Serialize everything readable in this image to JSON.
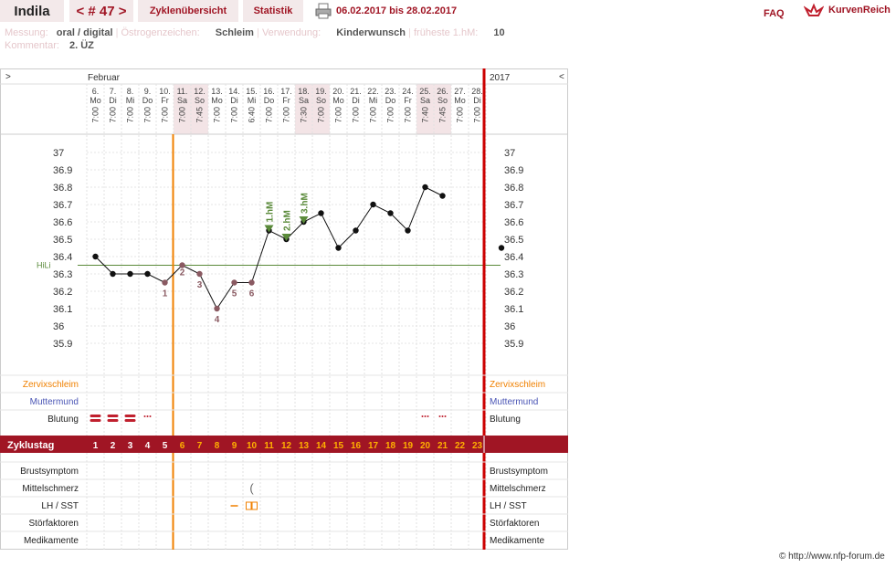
{
  "header": {
    "user": "Indila",
    "cycle": "< # 47 >",
    "tab_overview": "Zyklenübersicht",
    "tab_stats": "Statistik",
    "date_range": "06.02.2017 bis 28.02.2017",
    "faq": "FAQ",
    "brand": "KurvenReich"
  },
  "info": {
    "messung_label": "Messung:",
    "messung_value": "oral / digital",
    "oestro_label": "Östrogenzeichen:",
    "oestro_value": "Schleim",
    "verwendung_label": "Verwendung:",
    "verwendung_value": "Kinderwunsch",
    "hm_label": "früheste 1.hM:",
    "hm_value": "10",
    "kommentar_label": "Kommentar:",
    "kommentar_value": "2. ÜZ"
  },
  "chart_nav": {
    "left": ">",
    "right": "<",
    "month": "Februar",
    "year": "2017"
  },
  "chart_data": {
    "type": "line",
    "title": "",
    "ylim": [
      35.9,
      37.0
    ],
    "yticks": [
      "37",
      "36.9",
      "36.8",
      "36.7",
      "36.6",
      "36.5",
      "36.4",
      "36.3",
      "36.2",
      "36.1",
      "36",
      "35.9"
    ],
    "hili": {
      "label": "HiLi",
      "value": 36.35
    },
    "days": [
      {
        "date": "6.",
        "wd": "Mo",
        "time": "7:00",
        "temp": 36.4,
        "cd": "1",
        "we": false,
        "mark": "",
        "bleed": "heavy"
      },
      {
        "date": "7.",
        "wd": "Di",
        "time": "7:00",
        "temp": 36.3,
        "cd": "2",
        "we": false,
        "mark": "",
        "bleed": "heavy"
      },
      {
        "date": "8.",
        "wd": "Mi",
        "time": "7:00",
        "temp": 36.3,
        "cd": "3",
        "we": false,
        "mark": "",
        "bleed": "heavy"
      },
      {
        "date": "9.",
        "wd": "Do",
        "time": "7:00",
        "temp": 36.3,
        "cd": "4",
        "we": false,
        "mark": "",
        "bleed": "spot"
      },
      {
        "date": "10.",
        "wd": "Fr",
        "time": "7:00",
        "temp": 36.25,
        "cd": "5",
        "we": false,
        "mark": "1",
        "bleed": ""
      },
      {
        "date": "11.",
        "wd": "Sa",
        "time": "7:00",
        "temp": 36.35,
        "cd": "6",
        "we": true,
        "mark": "2",
        "bleed": ""
      },
      {
        "date": "12.",
        "wd": "So",
        "time": "7:45",
        "temp": 36.3,
        "cd": "7",
        "we": true,
        "mark": "3",
        "bleed": ""
      },
      {
        "date": "13.",
        "wd": "Mo",
        "time": "7:00",
        "temp": 36.1,
        "cd": "8",
        "we": false,
        "mark": "4",
        "bleed": ""
      },
      {
        "date": "14.",
        "wd": "Di",
        "time": "7:00",
        "temp": 36.25,
        "cd": "9",
        "we": false,
        "mark": "5",
        "bleed": ""
      },
      {
        "date": "15.",
        "wd": "Mi",
        "time": "6:40",
        "temp": 36.25,
        "cd": "10",
        "we": false,
        "mark": "6",
        "bleed": ""
      },
      {
        "date": "16.",
        "wd": "Do",
        "time": "7:00",
        "temp": 36.55,
        "cd": "11",
        "we": false,
        "mark": "1.hM",
        "bleed": ""
      },
      {
        "date": "17.",
        "wd": "Fr",
        "time": "7:00",
        "temp": 36.5,
        "cd": "12",
        "we": false,
        "mark": "2.hM",
        "bleed": ""
      },
      {
        "date": "18.",
        "wd": "Sa",
        "time": "7:30",
        "temp": 36.6,
        "cd": "13",
        "we": true,
        "mark": "3.hM",
        "bleed": ""
      },
      {
        "date": "19.",
        "wd": "So",
        "time": "7:00",
        "temp": 36.65,
        "cd": "14",
        "we": true,
        "mark": "",
        "bleed": ""
      },
      {
        "date": "20.",
        "wd": "Mo",
        "time": "7:00",
        "temp": 36.45,
        "cd": "15",
        "we": false,
        "mark": "",
        "bleed": ""
      },
      {
        "date": "21.",
        "wd": "Di",
        "time": "7:00",
        "temp": 36.55,
        "cd": "16",
        "we": false,
        "mark": "",
        "bleed": ""
      },
      {
        "date": "22.",
        "wd": "Mi",
        "time": "7:00",
        "temp": 36.7,
        "cd": "17",
        "we": false,
        "mark": "",
        "bleed": ""
      },
      {
        "date": "23.",
        "wd": "Do",
        "time": "7:00",
        "temp": 36.65,
        "cd": "18",
        "we": false,
        "mark": "",
        "bleed": ""
      },
      {
        "date": "24.",
        "wd": "Fr",
        "time": "7:00",
        "temp": 36.55,
        "cd": "19",
        "we": false,
        "mark": "",
        "bleed": ""
      },
      {
        "date": "25.",
        "wd": "Sa",
        "time": "7:40",
        "temp": 36.8,
        "cd": "20",
        "we": true,
        "mark": "",
        "bleed": "spot"
      },
      {
        "date": "26.",
        "wd": "So",
        "time": "7:45",
        "temp": 36.75,
        "cd": "21",
        "we": true,
        "mark": "",
        "bleed": "spot"
      },
      {
        "date": "27.",
        "wd": "Mo",
        "time": "7:00",
        "temp": null,
        "cd": "22",
        "we": false,
        "mark": "",
        "bleed": ""
      },
      {
        "date": "28.",
        "wd": "Di",
        "time": "7:00",
        "temp": null,
        "cd": "23",
        "we": false,
        "mark": "",
        "bleed": ""
      }
    ],
    "projected_temp": 36.45
  },
  "rows": {
    "zervix": "Zervixschleim",
    "muttermund": "Muttermund",
    "blutung": "Blutung",
    "zyklustag": "Zyklustag",
    "brust": "Brustsymptom",
    "mittel": "Mittelschmerz",
    "lh": "LH / SST",
    "stoer": "Störfaktoren",
    "medi": "Medikamente"
  },
  "colors": {
    "accent": "#a01524",
    "orange": "#f08000",
    "red_line": "#cc0000",
    "green": "#5a8a3a",
    "blue": "#4a55b5"
  },
  "footer": {
    "copyright": "© http://www.nfp-forum.de"
  }
}
